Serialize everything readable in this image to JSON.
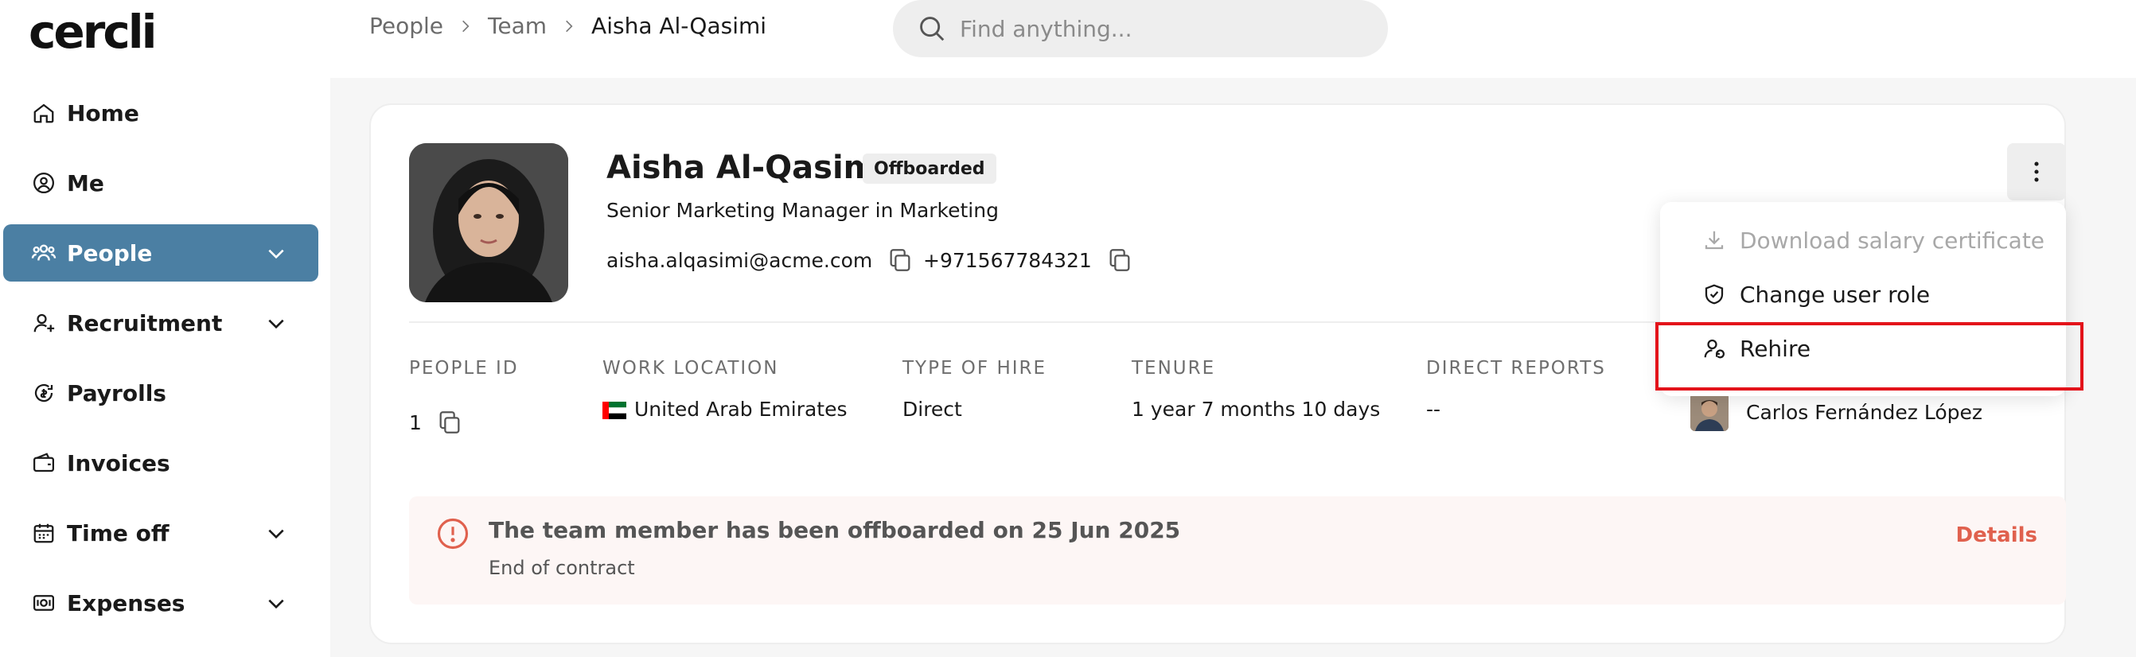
{
  "app": {
    "logo": "cercli"
  },
  "sidebar": {
    "items": [
      {
        "label": "Home",
        "icon": "home-icon",
        "active": false,
        "has_chevron": false
      },
      {
        "label": "Me",
        "icon": "user-circle-icon",
        "active": false,
        "has_chevron": false
      },
      {
        "label": "People",
        "icon": "people-icon",
        "active": true,
        "has_chevron": true
      },
      {
        "label": "Recruitment",
        "icon": "user-plus-icon",
        "active": false,
        "has_chevron": true
      },
      {
        "label": "Payrolls",
        "icon": "payroll-icon",
        "active": false,
        "has_chevron": false
      },
      {
        "label": "Invoices",
        "icon": "wallet-icon",
        "active": false,
        "has_chevron": false
      },
      {
        "label": "Time off",
        "icon": "calendar-icon",
        "active": false,
        "has_chevron": true
      },
      {
        "label": "Expenses",
        "icon": "money-icon",
        "active": false,
        "has_chevron": true
      }
    ]
  },
  "breadcrumb": {
    "items": [
      "People",
      "Team",
      "Aisha Al-Qasimi"
    ]
  },
  "search": {
    "placeholder": "Find anything..."
  },
  "profile": {
    "name": "Aisha Al-Qasimi",
    "status_badge": "Offboarded",
    "subtitle": "Senior Marketing Manager in Marketing",
    "email": "aisha.alqasimi@acme.com",
    "phone": "+971567784321"
  },
  "info": {
    "people_id_label": "PEOPLE ID",
    "people_id": "1",
    "work_location_label": "WORK LOCATION",
    "work_location": "United Arab Emirates",
    "type_of_hire_label": "TYPE OF HIRE",
    "type_of_hire": "Direct",
    "tenure_label": "TENURE",
    "tenure": "1 year 7 months 10 days",
    "direct_reports_label": "DIRECT REPORTS",
    "direct_reports": "--",
    "manager": "Carlos Fernández López"
  },
  "alert": {
    "title": "The team member has been offboarded on 25 Jun 2025",
    "subtitle": "End of contract",
    "link": "Details"
  },
  "menu": {
    "items": [
      {
        "label": "Download salary certificate",
        "icon": "download-icon",
        "disabled": true
      },
      {
        "label": "Change user role",
        "icon": "shield-check-icon",
        "disabled": false
      },
      {
        "label": "Rehire",
        "icon": "user-rehire-icon",
        "disabled": false
      }
    ]
  },
  "colors": {
    "accent": "#4b7fa3",
    "danger_link": "#e0614e",
    "highlight": "#e3131a",
    "alert_bg": "#fdf6f5"
  }
}
